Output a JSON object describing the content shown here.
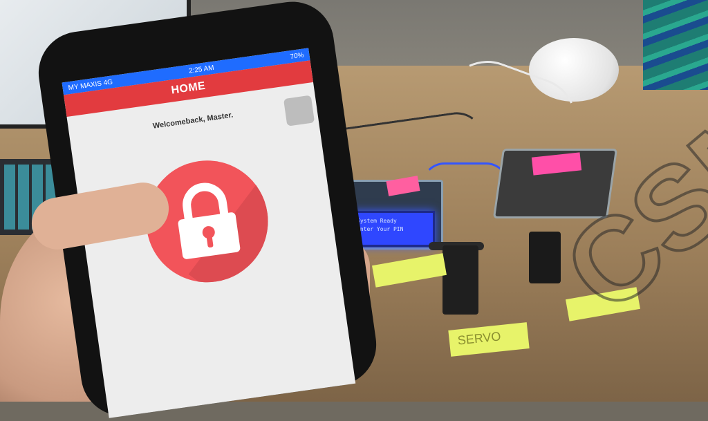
{
  "status_bar": {
    "carrier": "MY MAXIS 4G",
    "time": "2:25 AM",
    "battery": "70%"
  },
  "header": {
    "title": "HOME"
  },
  "main": {
    "welcome_text": "Welcomeback, Master."
  },
  "scene": {
    "lcd_line1": "System Ready",
    "lcd_line2": "Enter Your PIN",
    "note_servo": "SERVO"
  },
  "colors": {
    "status_bar": "#1f6cff",
    "app_bar": "#e23b3f",
    "lock_button": "#f2545a"
  },
  "icons": {
    "lock": "lock-icon"
  }
}
